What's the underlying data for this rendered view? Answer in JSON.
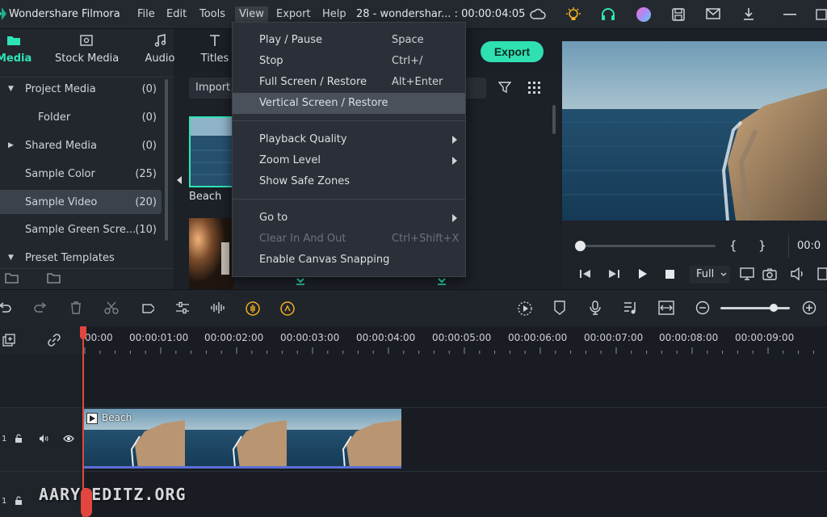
{
  "titlebar": {
    "app_name": "Wondershare Filmora",
    "menus": [
      "File",
      "Edit",
      "Tools",
      "View",
      "Export",
      "Help"
    ],
    "project": "28 - wondershar... : 00:00:04:05"
  },
  "tabs": [
    "Media",
    "Stock Media",
    "Audio",
    "Titles"
  ],
  "tree": [
    {
      "label": "Project Media",
      "count": "(0)"
    },
    {
      "label": "Folder",
      "count": "(0)"
    },
    {
      "label": "Shared Media",
      "count": "(0)"
    },
    {
      "label": "Sample Color",
      "count": "(25)"
    },
    {
      "label": "Sample Video",
      "count": "(20)"
    },
    {
      "label": "Sample Green Scre...",
      "count": "(10)"
    },
    {
      "label": "Preset Templates",
      "count": ""
    }
  ],
  "media": {
    "import_label": "Import",
    "thumb_label": "Beach"
  },
  "export_label": "Export",
  "view_menu": [
    {
      "label": "Play / Pause",
      "shortcut": "Space"
    },
    {
      "label": "Stop",
      "shortcut": "Ctrl+/"
    },
    {
      "label": "Full Screen / Restore",
      "shortcut": "Alt+Enter"
    },
    {
      "label": "Vertical Screen / Restore",
      "shortcut": ""
    },
    {
      "label": "Playback Quality",
      "shortcut": ""
    },
    {
      "label": "Zoom Level",
      "shortcut": ""
    },
    {
      "label": "Show Safe Zones",
      "shortcut": ""
    },
    {
      "label": "Go to",
      "shortcut": ""
    },
    {
      "label": "Clear In And Out",
      "shortcut": "Ctrl+Shift+X"
    },
    {
      "label": "Enable Canvas Snapping",
      "shortcut": ""
    }
  ],
  "preview": {
    "mark_in": "{",
    "mark_out": "}",
    "timecode": "00:0",
    "quality": "Full"
  },
  "timeline": {
    "ruler": [
      "00:00",
      "00:00:01:00",
      "00:00:02:00",
      "00:00:03:00",
      "00:00:04:00",
      "00:00:05:00",
      "00:00:06:00",
      "00:00:07:00",
      "00:00:08:00",
      "00:00:09:00"
    ],
    "clip_name": "Beach",
    "track_number": "1",
    "watermark": "AARYAEDITZ.ORG"
  },
  "colors": {
    "accent": "#2fe0b1",
    "playhead": "#e2463e"
  }
}
